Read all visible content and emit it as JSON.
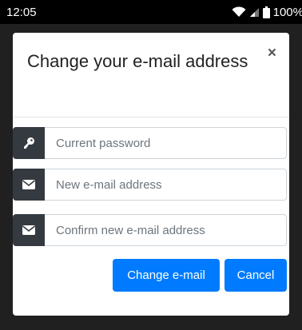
{
  "status_bar": {
    "time": "12:05",
    "battery": "100%"
  },
  "modal": {
    "title": "Change your e-mail address",
    "close_symbol": "×",
    "fields": [
      {
        "icon": "key-icon",
        "placeholder": "Current password"
      },
      {
        "icon": "envelope-icon",
        "placeholder": "New e-mail address"
      },
      {
        "icon": "envelope-icon",
        "placeholder": "Confirm new e-mail address"
      }
    ],
    "primary_button": "Change e-mail",
    "cancel_button": "Cancel"
  },
  "colors": {
    "primary": "#007bff",
    "addon": "#343a40",
    "backdrop": "#202020"
  }
}
